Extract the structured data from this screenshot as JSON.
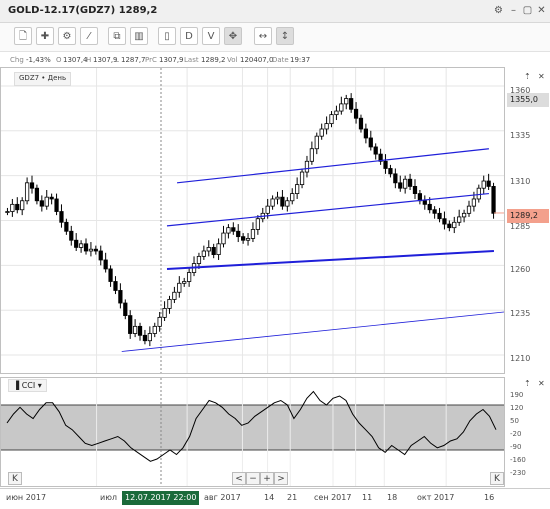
{
  "window": {
    "title": "GOLD-12.17(GDZ7) 1289,2",
    "settings_icon": "gear-icon",
    "minimize_icon": "minimize-icon",
    "maximize_icon": "maximize-icon",
    "close_icon": "close-icon"
  },
  "toolbar": {
    "buttons": [
      {
        "icon": "new-page-icon",
        "glyph": "🗋"
      },
      {
        "icon": "add-indicator-icon",
        "glyph": "✚"
      },
      {
        "icon": "settings-icon",
        "glyph": "⚙"
      },
      {
        "icon": "drawing-icon",
        "glyph": "⁄⁄"
      },
      {
        "icon": "add-chart-icon",
        "glyph": "⧉"
      },
      {
        "icon": "bar-chart-icon",
        "glyph": "▥"
      },
      {
        "icon": "cursor-icon",
        "glyph": "▯"
      },
      {
        "label": "D"
      },
      {
        "label": "V"
      },
      {
        "icon": "crosshair-icon",
        "glyph": "✥"
      },
      {
        "icon": "fit-horizontal-icon",
        "glyph": "↔"
      },
      {
        "icon": "fit-vertical-icon",
        "glyph": "↕"
      }
    ]
  },
  "info": {
    "chg_label": "Chg",
    "chg": "-1,43%",
    "o_label": "O",
    "o": "1307,4",
    "h_label": "H",
    "h": "1307,9",
    "l_label": "L",
    "l": "1287,7",
    "prc_label": "PrC",
    "prc": "1307,9",
    "last_label": "Last",
    "last": "1289,2",
    "vol_label": "Vol",
    "vol": "120407,0",
    "date_label": "Date",
    "date": "19:37"
  },
  "chart_legend": "GDZ7 • День",
  "price_axis": {
    "ticks": [
      "1360",
      "1335",
      "1310",
      "1285",
      "1260",
      "1235",
      "1210"
    ],
    "badge_high": "1355,0",
    "badge_last": "1289,2"
  },
  "indicator": {
    "name": "CCI",
    "ticks": [
      "190",
      "120",
      "50",
      "-20",
      "-90",
      "-160",
      "-230"
    ]
  },
  "navigator": {
    "k": "K",
    "left": "<",
    "minus": "−",
    "plus": "+",
    "right": ">",
    "k_right": "K"
  },
  "x_axis": {
    "ticks": [
      {
        "label": "июн 2017",
        "pos": 0.0
      },
      {
        "label": "июл",
        "pos": 0.19
      },
      {
        "label": "авг 2017",
        "pos": 0.37
      },
      {
        "label": "14",
        "pos": 0.48
      },
      {
        "label": "21",
        "pos": 0.53
      },
      {
        "label": "сен 2017",
        "pos": 0.575
      },
      {
        "label": "11",
        "pos": 0.66
      },
      {
        "label": "18",
        "pos": 0.705
      },
      {
        "label": "окт 2017",
        "pos": 0.762
      },
      {
        "label": "16",
        "pos": 0.885
      }
    ],
    "cursor_label": "12.07.2017 22:00"
  },
  "colors": {
    "up": "#ffffff",
    "down": "#000000",
    "channel": "#1f1fd9",
    "grid": "#e6e6e6",
    "badge_high": "#dcdcdc",
    "badge_last": "#f3a08c",
    "cci_band": "#c8c8c8"
  },
  "chart_data": {
    "type": "candlestick",
    "y_range": [
      1200,
      1370
    ],
    "last_price": 1289.2,
    "high_marker": 1355.0,
    "closes": [
      1290,
      1294,
      1291,
      1296,
      1306,
      1303,
      1296,
      1293,
      1298,
      1297,
      1290,
      1284,
      1279,
      1274,
      1270,
      1272,
      1268,
      1269,
      1268,
      1263,
      1258,
      1251,
      1246,
      1239,
      1232,
      1222,
      1226,
      1221,
      1218,
      1222,
      1226,
      1231,
      1236,
      1241,
      1245,
      1250,
      1251,
      1256,
      1261,
      1265,
      1268,
      1270,
      1266,
      1272,
      1278,
      1281,
      1279,
      1276,
      1274,
      1275,
      1280,
      1286,
      1289,
      1293,
      1297,
      1298,
      1293,
      1296,
      1300,
      1305,
      1312,
      1318,
      1325,
      1332,
      1336,
      1339,
      1344,
      1346,
      1350,
      1353,
      1347,
      1342,
      1336,
      1331,
      1326,
      1322,
      1318,
      1314,
      1311,
      1306,
      1303,
      1308,
      1304,
      1300,
      1296,
      1294,
      1291,
      1289,
      1286,
      1283,
      1281,
      1284,
      1287,
      1289,
      1293,
      1297,
      1303,
      1307,
      1304,
      1289
    ],
    "channel_lines": [
      {
        "x1": 0.35,
        "y1": 1306,
        "x2": 0.97,
        "y2": 1325
      },
      {
        "x1": 0.33,
        "y1": 1282,
        "x2": 0.97,
        "y2": 1300
      },
      {
        "x1": 0.33,
        "y1": 1258,
        "x2": 0.98,
        "y2": 1268
      },
      {
        "x1": 0.24,
        "y1": 1212,
        "x2": 1.0,
        "y2": 1234
      }
    ],
    "cci": [
      20,
      60,
      90,
      60,
      40,
      80,
      110,
      110,
      70,
      10,
      -10,
      -40,
      -70,
      -80,
      -70,
      -60,
      -50,
      -40,
      -60,
      -90,
      -110,
      -130,
      -150,
      -140,
      -120,
      -100,
      -120,
      -90,
      -40,
      40,
      80,
      120,
      110,
      90,
      60,
      40,
      10,
      20,
      50,
      70,
      90,
      110,
      120,
      100,
      40,
      80,
      130,
      160,
      120,
      100,
      130,
      140,
      120,
      60,
      20,
      -10,
      -40,
      -90,
      -110,
      -80,
      -100,
      -120,
      -80,
      -60,
      -40,
      -70,
      -90,
      -80,
      -60,
      -50,
      -20,
      30,
      60,
      80,
      50,
      -10
    ]
  }
}
